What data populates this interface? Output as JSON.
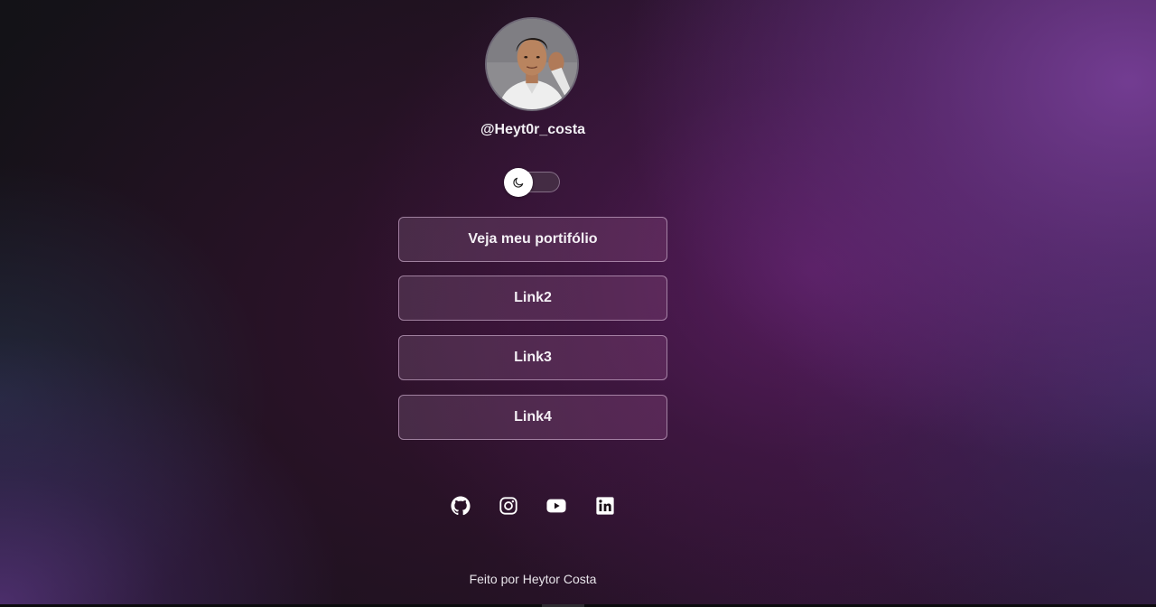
{
  "profile": {
    "username": "@Heyt0r_costa"
  },
  "theme_toggle": {
    "icon": "moon-icon",
    "state": "dark"
  },
  "links": [
    {
      "label": "Veja meu portifólio"
    },
    {
      "label": "Link2"
    },
    {
      "label": "Link3"
    },
    {
      "label": "Link4"
    }
  ],
  "social": [
    {
      "icon": "github-icon"
    },
    {
      "icon": "instagram-icon"
    },
    {
      "icon": "youtube-icon"
    },
    {
      "icon": "linkedin-icon"
    }
  ],
  "footer": {
    "text": "Feito por Heytor Costa"
  },
  "colors": {
    "button_border": "#d9b8d9",
    "accent_purple": "#6c3a8c",
    "text": "#ffffff"
  }
}
